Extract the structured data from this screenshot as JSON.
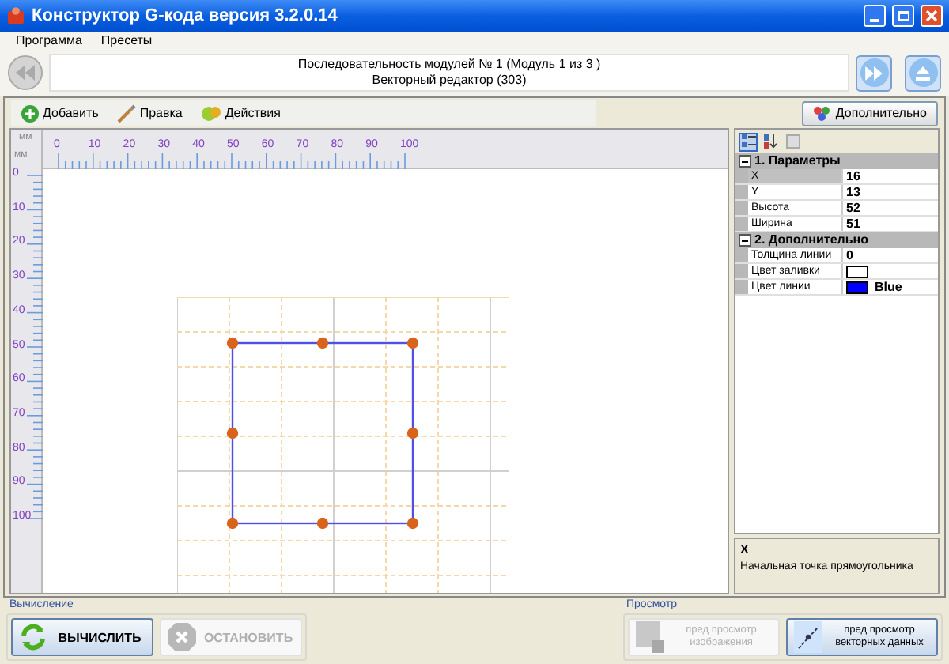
{
  "window": {
    "title": "Конструктор G-кода версия 3.2.0.14"
  },
  "menu": [
    {
      "label": "Программа"
    },
    {
      "label": "Пресеты"
    }
  ],
  "navigation": {
    "line_1": "Последовательность модулей № 1 (Модуль 1 из 3 )",
    "line_2": "Векторный редактор (303)"
  },
  "toolbar": [
    {
      "label": "Добавить",
      "kind": "add"
    },
    {
      "label": "Правка",
      "kind": "edit"
    },
    {
      "label": "Действия",
      "kind": "actions"
    }
  ],
  "extra_button": "Дополнительно",
  "ruler": {
    "unit_top": "мм",
    "unit_left": "мм",
    "x_labels": [
      "0",
      "10",
      "20",
      "30",
      "40",
      "50",
      "60",
      "70",
      "80",
      "90",
      "100"
    ],
    "y_labels": [
      "0",
      "10",
      "20",
      "30",
      "40",
      "50",
      "60",
      "70",
      "80",
      "90",
      "100"
    ]
  },
  "properties": {
    "sort_buttons": [
      {
        "kind": "categorized",
        "selected": true
      },
      {
        "kind": "alphabetical",
        "selected": false
      },
      {
        "kind": "pages",
        "selected": false
      }
    ],
    "categories": [
      {
        "title": "1. Параметры",
        "expanded": true,
        "rows": [
          {
            "name": "X",
            "value": "16",
            "selected": true
          },
          {
            "name": "Y",
            "value": "13",
            "selected": false
          },
          {
            "name": "Высота",
            "value": "52",
            "selected": false
          },
          {
            "name": "Ширина",
            "value": "51",
            "selected": false
          }
        ]
      },
      {
        "title": "2. Дополнительно",
        "expanded": true,
        "rows": [
          {
            "name": "Толщина линии",
            "value": "0",
            "selected": false
          },
          {
            "name": "Цвет заливки",
            "color": "#ffffff",
            "selected": false
          },
          {
            "name": "Цвет линии",
            "value": "Blue",
            "color": "#0000ff",
            "selected": false
          }
        ]
      }
    ],
    "description": {
      "title": "X",
      "text": "Начальная точка прямоугольника"
    }
  },
  "groups": [
    {
      "title": "Вычисление",
      "buttons": [
        {
          "label": "ВЫЧИСЛИТЬ",
          "kind": "calculate",
          "disabled": false
        },
        {
          "label": "ОСТАНОВИТЬ",
          "kind": "stop",
          "disabled": true
        }
      ]
    },
    {
      "title": "Просмотр",
      "buttons": [
        {
          "label": "пред просмотр изображения",
          "kind": "image",
          "disabled": true
        },
        {
          "label": "пред просмотр векторных данных",
          "kind": "vector",
          "disabled": false
        }
      ]
    }
  ]
}
